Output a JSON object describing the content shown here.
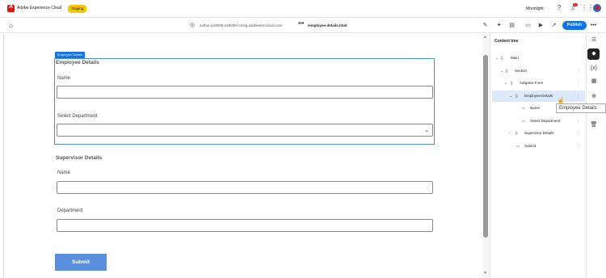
{
  "topbar": {
    "app_title": "Adobe Experience Cloud",
    "env_badge": "Staging",
    "tenant": "Moonlight",
    "icons": [
      "help-icon",
      "bell-icon",
      "apps-grid-icon",
      "avatar"
    ]
  },
  "toolbar": {
    "url_host": "author-p10005-e29039-cmstg.adobeaemcloud.com",
    "url_ellipsis": "•••",
    "url_page": "/employee-details.html",
    "publish_label": "Publish",
    "more_label": "•••"
  },
  "form": {
    "chip_label": "Employee Details",
    "employee_section_title": "Employee Details",
    "name_label": "Name",
    "department_label": "Select Department",
    "supervisor_section_title": "Supervisor Details",
    "supervisor_name_label": "Name",
    "supervisor_department_label": "Department",
    "submit_label": "Submit"
  },
  "content_tree": {
    "title": "Content tree",
    "items": [
      {
        "label": "Main"
      },
      {
        "label": "Section"
      },
      {
        "label": "Adaptive Form"
      },
      {
        "label": "Employee Details"
      },
      {
        "label": "Name"
      },
      {
        "label": "Select Department"
      },
      {
        "label": "Supervisor Details"
      },
      {
        "label": "Submit"
      }
    ],
    "tooltip": "Employee Details"
  },
  "colors": {
    "publish": "#1473e6",
    "staging_badge": "#f2c600",
    "submit": "#5a8fdf",
    "selected_row": "#dbe9fb"
  }
}
